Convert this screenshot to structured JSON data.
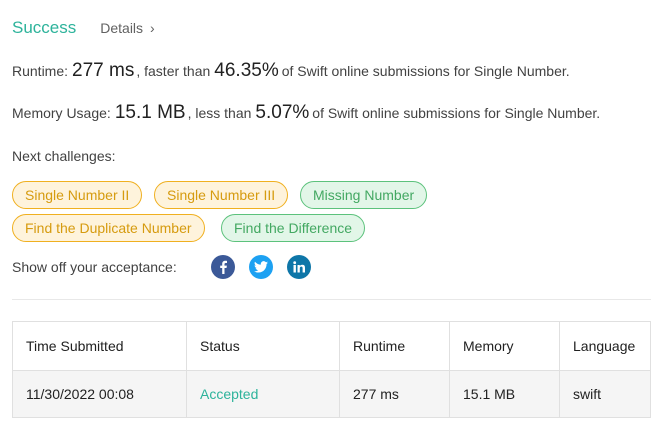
{
  "header": {
    "status": "Success",
    "details_label": "Details",
    "details_chevron": "›"
  },
  "runtime": {
    "label": "Runtime:",
    "value": "277 ms",
    "mid": ", faster than",
    "percent": "46.35%",
    "tail": "of Swift online submissions for Single Number."
  },
  "memory": {
    "label": "Memory Usage:",
    "value": "15.1 MB",
    "mid": ", less than",
    "percent": "5.07%",
    "tail": "of Swift online submissions for Single Number."
  },
  "next_challenges": {
    "label": "Next challenges:",
    "items": [
      {
        "label": "Single Number II",
        "difficulty": "medium"
      },
      {
        "label": "Single Number III",
        "difficulty": "medium"
      },
      {
        "label": "Missing Number",
        "difficulty": "easy"
      },
      {
        "label": "Find the Duplicate Number",
        "difficulty": "medium"
      },
      {
        "label": "Find the Difference",
        "difficulty": "easy"
      }
    ]
  },
  "share": {
    "label": "Show off your acceptance:",
    "icons": [
      "facebook-icon",
      "twitter-icon",
      "linkedin-icon"
    ]
  },
  "table": {
    "headers": [
      "Time Submitted",
      "Status",
      "Runtime",
      "Memory",
      "Language"
    ],
    "rows": [
      [
        "11/30/2022 00:08",
        "Accepted",
        "277 ms",
        "15.1 MB",
        "swift"
      ]
    ]
  },
  "colors": {
    "success": "#2db39b",
    "medium_text": "#d69b0f",
    "easy_text": "#43a862",
    "facebook": "#3b5998",
    "twitter": "#1da1f2",
    "linkedin": "#0e76a8"
  }
}
